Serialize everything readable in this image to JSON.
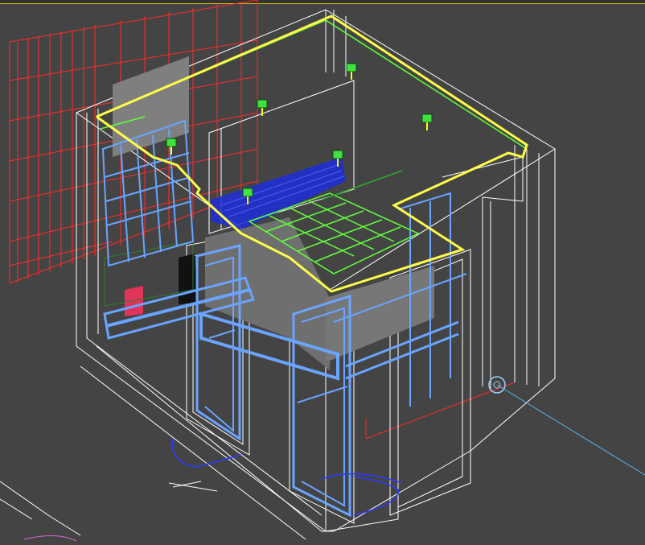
{
  "viewport": {
    "kind": "3d-wireframe",
    "view": "perspective",
    "background": "#444444",
    "active_border": "#d6b21c"
  },
  "colors": {
    "room_shell": "#ffffff",
    "wall_panels": "#ff2a2a",
    "blue_doors_and_frames": "#6aa4ff",
    "green_ceiling_grid": "#62ff3b",
    "yellow_selected_outline": "#ffff4a",
    "dark_blue_fill": "#1d2ed8",
    "light_gizmo": "#3fe23f"
  },
  "icons": [
    "omni-light-icon",
    "omni-light-icon",
    "omni-light-icon",
    "omni-light-icon",
    "omni-light-icon",
    "omni-light-icon",
    "camera-target-icon"
  ]
}
